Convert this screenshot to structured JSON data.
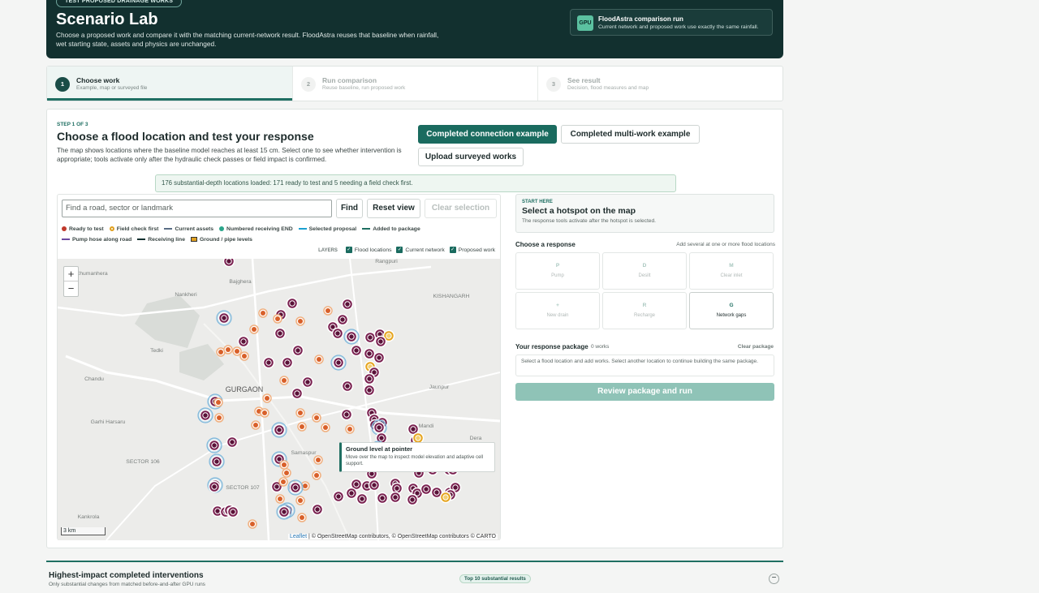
{
  "header": {
    "badge": "TEST PROPOSED DRAINAGE WORKS",
    "title": "Scenario Lab",
    "description": "Choose a proposed work and compare it with the matching current-network result. FloodAstra reuses that baseline when rainfall, wet starting state, assets and physics are unchanged.",
    "gpu_chip": "GPU",
    "gpu_title": "FloodAstra comparison run",
    "gpu_subtitle": "Current network and proposed work use exactly the same rainfall."
  },
  "steps": [
    {
      "num": "1",
      "title": "Choose work",
      "subtitle": "Example, map or surveyed file"
    },
    {
      "num": "2",
      "title": "Run comparison",
      "subtitle": "Reuse baseline, run proposed work"
    },
    {
      "num": "3",
      "title": "See result",
      "subtitle": "Decision, flood measures and map"
    }
  ],
  "panel": {
    "kicker": "STEP 1 OF 3",
    "title": "Choose a flood location and test your response",
    "description": "The map shows locations where the baseline model reaches at least 15 cm. Select one to see whether intervention is appropriate; tools activate only after the hydraulic check passes or field impact is confirmed.",
    "btn_connection": "Completed connection example",
    "btn_multi": "Completed multi-work example",
    "btn_upload": "Upload surveyed works",
    "notice": "176 substantial-depth locations loaded: 171 ready to test and 5 needing a field check first."
  },
  "map": {
    "search_placeholder": "Find a road, sector or landmark",
    "find": "Find",
    "reset": "Reset view",
    "clear": "Clear selection",
    "legend": [
      {
        "label": "Ready to test",
        "kind": "dot",
        "color": "#c0392b"
      },
      {
        "label": "Field check first",
        "kind": "ring",
        "color": "#e0a020"
      },
      {
        "label": "Current assets",
        "kind": "line",
        "color": "#5a6d85"
      },
      {
        "label": "Numbered receiving END",
        "kind": "dot",
        "color": "#2aa58a"
      },
      {
        "label": "Selected proposal",
        "kind": "line",
        "color": "#1aa0d0"
      },
      {
        "label": "Added to package",
        "kind": "line",
        "color": "#1f6f62"
      },
      {
        "label": "Pump hose along road",
        "kind": "line",
        "color": "#6b4aa0"
      },
      {
        "label": "Receiving line",
        "kind": "line",
        "color": "#12302f"
      },
      {
        "label": "Ground / pipe levels",
        "kind": "box",
        "color": "#e0a020"
      }
    ],
    "layers_label": "LAYERS",
    "layers": [
      "Flood locations",
      "Current network",
      "Proposed work"
    ],
    "places": [
      "Rangpuri",
      "Chumanhera",
      "Bajghera",
      "Nankheri",
      "KISHANGARH",
      "Tedki",
      "Chandu",
      "GURGAON",
      "Jaunpur",
      "Garhi Harsaru",
      "Mandi",
      "Dera",
      "SECTOR 106",
      "Samaspur",
      "SECTOR 107",
      "Kankrola"
    ],
    "zoom_in": "+",
    "zoom_out": "−",
    "scale": "3 km",
    "attribution_leaflet": "Leaflet",
    "attribution_rest": " | © OpenStreetMap contributors, © OpenStreetMap contributors © CARTO",
    "tooltip_title": "Ground level at pointer",
    "tooltip_desc": "Move over the map to inspect model elevation and adaptive cell support."
  },
  "side": {
    "kicker": "START HERE",
    "title": "Select a hotspot on the map",
    "desc": "The response tools activate after the hotspot is selected.",
    "choose": "Choose a response",
    "choose_note": "Add several at one or more flood locations",
    "tools": [
      {
        "letter": "P",
        "name": "Pump",
        "active": false
      },
      {
        "letter": "D",
        "name": "Desilt",
        "active": false
      },
      {
        "letter": "M",
        "name": "Clear inlet",
        "active": false
      },
      {
        "letter": "+",
        "name": "New drain",
        "active": false
      },
      {
        "letter": "R",
        "name": "Recharge",
        "active": false
      },
      {
        "letter": "G",
        "name": "Network gaps",
        "active": true
      }
    ],
    "package_title": "Your response package",
    "package_count": "0 works",
    "package_clear": "Clear package",
    "package_empty": "Select a flood location and add works. Select another location to continue building the same package.",
    "review": "Review package and run"
  },
  "bottom": {
    "title": "Highest-impact completed interventions",
    "subtitle": "Only substantial changes from matched before-and-after GPU runs",
    "badge": "Top 10 substantial results",
    "collapse": "−"
  }
}
